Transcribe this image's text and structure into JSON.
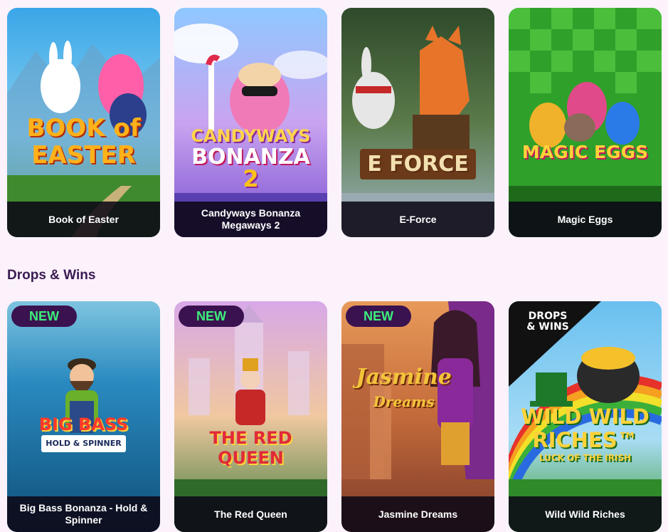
{
  "top_games": [
    {
      "title": "Book of Easter",
      "logo_lines": [
        "BOOK of",
        "EASTER"
      ]
    },
    {
      "title": "Candyways Bonanza Megaways 2",
      "logo_lines": [
        "CANDYWAYS",
        "BONANZA",
        "2"
      ]
    },
    {
      "title": "E-Force",
      "logo_lines": [
        "E FORCE"
      ]
    },
    {
      "title": "Magic Eggs",
      "logo_lines": [
        "MAGIC EGGS"
      ]
    }
  ],
  "section": {
    "title": "Drops & Wins"
  },
  "drops_games": [
    {
      "title": "Big Bass Bonanza - Hold & Spinner",
      "badge": "NEW",
      "logo_lines": [
        "BIG BASS",
        "HOLD & SPINNER"
      ]
    },
    {
      "title": "The Red Queen",
      "badge": "NEW",
      "logo_lines": [
        "THE RED QUEEN"
      ]
    },
    {
      "title": "Jasmine Dreams",
      "badge": "NEW",
      "logo_lines": [
        "Jasmine",
        "Dreams"
      ]
    },
    {
      "title": "Wild Wild Riches",
      "logo_lines": [
        "DROPS",
        "& WINS",
        "WILD WILD",
        "RICHES™",
        "LUCK OF THE IRISH"
      ]
    }
  ],
  "colors": {
    "page_bg": "#fbf2fb",
    "badge_bg": "#3a1250",
    "badge_text": "#3cf07a",
    "section_title": "#3a1a52"
  }
}
